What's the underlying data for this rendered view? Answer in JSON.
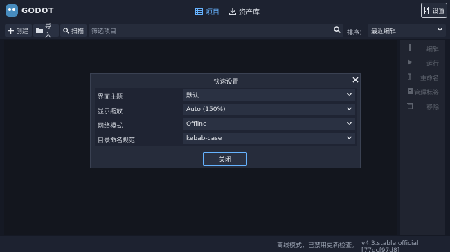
{
  "app": {
    "logo_text": "GODOT"
  },
  "main_tabs": [
    {
      "label": "项目",
      "icon": "list-icon",
      "active": true
    },
    {
      "label": "资产库",
      "icon": "download-icon",
      "active": false
    }
  ],
  "settings_button": {
    "label": "设置",
    "icon": "sliders-icon"
  },
  "toolbar": {
    "create_label": "创建",
    "import_label": "导入",
    "scan_label": "扫描",
    "filter_placeholder": "筛选项目",
    "sort_label": "排序：",
    "sort_value": "最近编辑"
  },
  "side_actions": [
    {
      "label": "编辑",
      "icon": "edit-icon"
    },
    {
      "label": "运行",
      "icon": "play-icon"
    },
    {
      "label": "重命名",
      "icon": "rename-icon"
    },
    {
      "label": "管理标签",
      "icon": "tag-icon"
    },
    {
      "label": "移除",
      "icon": "trash-icon"
    }
  ],
  "dialog": {
    "title": "快速设置",
    "rows": [
      {
        "label": "界面主题",
        "value": "默认"
      },
      {
        "label": "显示缩放",
        "value": "Auto (150%)"
      },
      {
        "label": "网络模式",
        "value": "Offline"
      },
      {
        "label": "目录命名规范",
        "value": "kebab-case"
      }
    ],
    "close_label": "关闭"
  },
  "status": {
    "message": "离线模式，已禁用更新检查。",
    "version": "v4.3.stable.official [77dcf97d8]"
  },
  "colors": {
    "accent": "#66b3ff",
    "background": "#1d2230",
    "panel": "#262c3b"
  }
}
